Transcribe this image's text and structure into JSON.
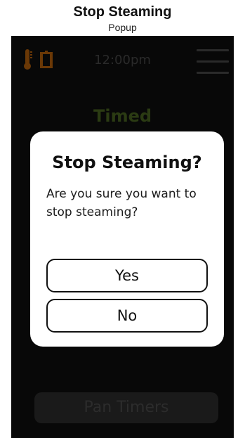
{
  "caption": {
    "title": "Stop Steaming",
    "subtitle": "Popup"
  },
  "header": {
    "time": "12:00pm",
    "icons": {
      "thermometer": "thermometer-icon",
      "door": "door-icon",
      "menu": "hamburger-menu-icon"
    }
  },
  "main": {
    "mode_label": "Timed",
    "pan_timers_label": "Pan Timers"
  },
  "dialog": {
    "title": "Stop Steaming?",
    "message": "Are you sure you want to stop steaming?",
    "yes_label": "Yes",
    "no_label": "No"
  },
  "colors": {
    "screen_background": "#080808",
    "accent_green": "#2b3b13",
    "icon_orange": "#6a3806",
    "dialog_background": "#ffffff"
  }
}
